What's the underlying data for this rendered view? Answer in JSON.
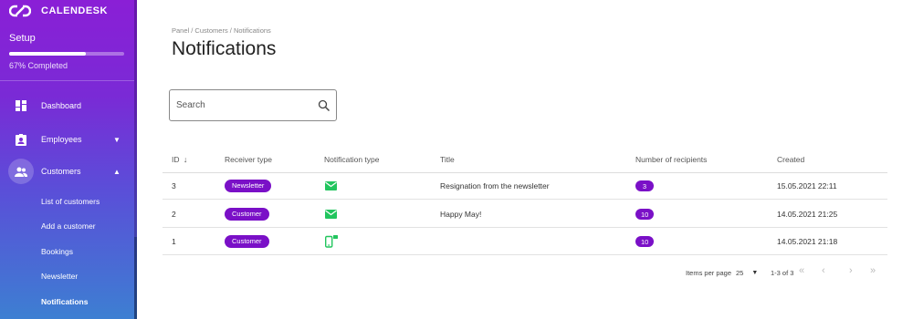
{
  "app": {
    "logo_text": "CALENDESK"
  },
  "setup": {
    "title": "Setup",
    "progress": 0.67,
    "status": "67% Completed"
  },
  "nav": {
    "dashboard": "Dashboard",
    "employees": "Employees",
    "customers": "Customers",
    "sub": {
      "list": "List of customers",
      "add": "Add a customer",
      "bookings": "Bookings",
      "newsletter": "Newsletter",
      "notifications": "Notifications"
    }
  },
  "page": {
    "breadcrumb": "Panel / Customers / Notifications",
    "title": "Notifications"
  },
  "search": {
    "placeholder": "Search"
  },
  "table": {
    "headers": {
      "id": "ID",
      "receiver_type": "Receiver type",
      "notification_type": "Notification type",
      "title": "Title",
      "recipients": "Number of recipients",
      "created": "Created"
    },
    "rows": [
      {
        "id": "3",
        "receiver_type": "Newsletter",
        "notification_type": "email-icon",
        "title": "Resignation from the newsletter",
        "recipients": "3",
        "created": "15.05.2021 22:11"
      },
      {
        "id": "2",
        "receiver_type": "Customer",
        "notification_type": "email-icon",
        "title": "Happy May!",
        "recipients": "10",
        "created": "14.05.2021 21:25"
      },
      {
        "id": "1",
        "receiver_type": "Customer",
        "notification_type": "sms-icon",
        "title": "",
        "recipients": "10",
        "created": "14.05.2021 21:18"
      }
    ]
  },
  "pagination": {
    "items_per_page_label": "Items per page",
    "items_per_page": "25",
    "range": "1-3 of 3"
  },
  "colors": {
    "accent": "#7a10c7",
    "icon_green": "#22c55e"
  }
}
